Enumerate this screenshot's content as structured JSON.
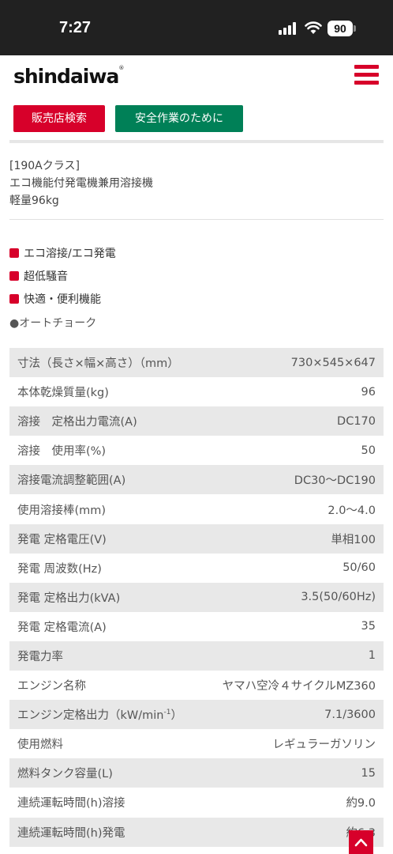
{
  "status_bar": {
    "time": "7:27",
    "battery": "90"
  },
  "header": {
    "logo": "shindaiwa",
    "logo_mark": "®"
  },
  "buttons": {
    "dealer_search": "販売店検索",
    "safety": "安全作業のために"
  },
  "model": {
    "line1": "[190Aクラス]",
    "line2": "エコ機能付発電機兼用溶接機",
    "line3": "軽量96kg"
  },
  "features": [
    {
      "label": "エコ溶接/エコ発電"
    },
    {
      "label": "超低騒音"
    },
    {
      "label": "快適・便利機能"
    },
    {
      "label": "●オートチョーク"
    }
  ],
  "specs": [
    {
      "label": "寸法（長さ×幅×高さ）（mm）",
      "value": "730×545×647"
    },
    {
      "label": "本体乾燥質量(kg)",
      "value": "96"
    },
    {
      "label": "溶接　定格出力電流(A)",
      "value": "DC170"
    },
    {
      "label": "溶接　使用率(%)",
      "value": "50"
    },
    {
      "label": "溶接電流調整範囲(A)",
      "value": "DC30〜DC190"
    },
    {
      "label": "使用溶接棒(mm)",
      "value": "2.0〜4.0"
    },
    {
      "label": "発電 定格電圧(V)",
      "value": "単相100"
    },
    {
      "label": "発電 周波数(Hz)",
      "value": "50/60"
    },
    {
      "label": "発電 定格出力(kVA)",
      "value": "3.5(50/60Hz)"
    },
    {
      "label": "発電 定格電流(A)",
      "value": "35"
    },
    {
      "label": "発電力率",
      "value": "1"
    },
    {
      "label": "エンジン名称",
      "value": "ヤマハ空冷４サイクルMZ360"
    },
    {
      "label": "エンジン定格出力（kW/min",
      "label_sup": "-1",
      "label_end": "）",
      "value": "7.1/3600"
    },
    {
      "label": "使用燃料",
      "value": "レギュラーガソリン"
    },
    {
      "label": "燃料タンク容量(L)",
      "value": "15"
    },
    {
      "label": "連続運転時間(h)溶接",
      "value": "約9.0"
    },
    {
      "label": "連続運転時間(h)発電",
      "value": "約6.3"
    }
  ],
  "colors": {
    "brand_red": "#d7002a",
    "safety_green": "#008057",
    "row_gray": "#e8e8e8"
  },
  "icons": {
    "menu": "hamburger-icon",
    "scroll_top": "chevron-up-icon",
    "wifi": "wifi-icon",
    "signal": "signal-icon"
  }
}
